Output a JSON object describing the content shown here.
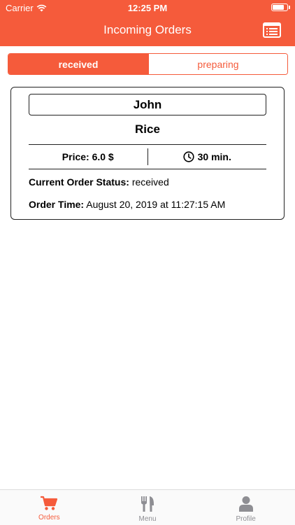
{
  "status_bar": {
    "carrier": "Carrier",
    "time": "12:25 PM",
    "battery_level": 0.85
  },
  "nav": {
    "title": "Incoming Orders",
    "action_icon": "list-icon"
  },
  "segments": [
    {
      "label": "received",
      "active": true
    },
    {
      "label": "preparing",
      "active": false
    }
  ],
  "order": {
    "customer": "John",
    "item": "Rice",
    "price": "Price: 6.0 $",
    "prep_time": "30 min.",
    "status_label": "Current Order Status:",
    "status_value": "received",
    "time_label": "Order Time:",
    "time_value": "August 20, 2019 at 11:27:15 AM"
  },
  "tabs": [
    {
      "label": "Orders",
      "icon": "cart-icon",
      "active": true
    },
    {
      "label": "Menu",
      "icon": "fork-knife-icon",
      "active": false
    },
    {
      "label": "Profile",
      "icon": "person-icon",
      "active": false
    }
  ],
  "colors": {
    "accent": "#f55b3b",
    "inactive_tab": "#8e8e93"
  }
}
